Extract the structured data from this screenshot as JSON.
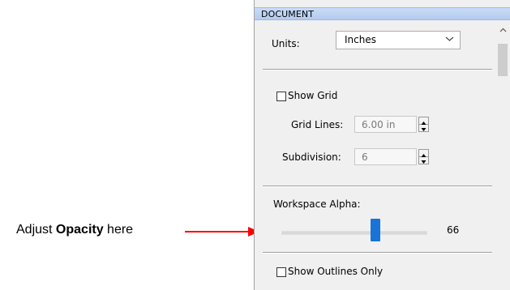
{
  "annotation": {
    "prefix": "Adjust ",
    "bold": "Opacity",
    "suffix": " here",
    "arrow_color": "#ff0000"
  },
  "panel": {
    "title": "DOCUMENT",
    "units_label": "Units:",
    "units_value": "Inches",
    "show_grid_label": "Show Grid",
    "show_grid_checked": false,
    "grid_lines_label": "Grid Lines:",
    "grid_lines_value": "6.00 in",
    "subdivision_label": "Subdivision:",
    "subdivision_value": "6",
    "workspace_alpha_label": "Workspace Alpha:",
    "workspace_alpha_value": "66",
    "workspace_alpha_level_percent": 66,
    "show_outlines_label": "Show Outlines Only",
    "show_outlines_checked": false
  },
  "colors": {
    "header_bg": "#c9dcf6",
    "panel_bg": "#f0f0f0",
    "slider_thumb": "#1a73d9"
  },
  "icons": [
    "chevron-down-icon",
    "spin-up-icon",
    "spin-down-icon",
    "scroll-up-icon",
    "arrow-icon"
  ]
}
